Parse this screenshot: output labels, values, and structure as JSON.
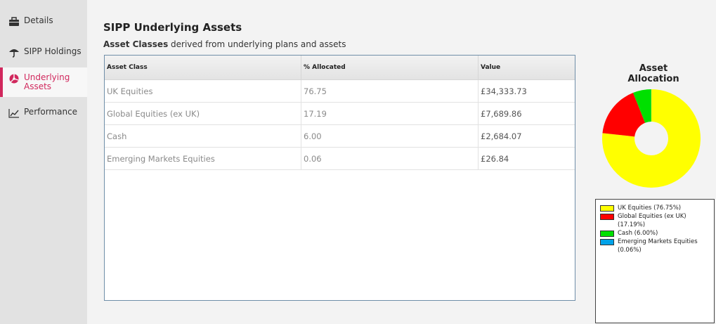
{
  "sidebar": {
    "items": [
      {
        "label": "Details",
        "icon": "briefcase-icon"
      },
      {
        "label": "SIPP Holdings",
        "icon": "umbrella-icon"
      },
      {
        "label": "Underlying Assets",
        "icon": "pie-chart-icon"
      },
      {
        "label": "Performance",
        "icon": "line-chart-icon"
      }
    ],
    "active_color": "#d1285d"
  },
  "main": {
    "title": "SIPP Underlying Assets",
    "subtitle_bold": "Asset Classes",
    "subtitle_rest": " derived from underlying plans and assets",
    "table": {
      "headers": [
        "Asset Class",
        "% Allocated",
        "Value"
      ],
      "rows": [
        [
          "UK Equities",
          "76.75",
          "£34,333.73"
        ],
        [
          "Global Equities (ex UK)",
          "17.19",
          "£7,689.86"
        ],
        [
          "Cash",
          "6.00",
          "£2,684.07"
        ],
        [
          "Emerging Markets Equities",
          "0.06",
          "£26.84"
        ]
      ]
    }
  },
  "chart_data": {
    "type": "pie",
    "title": "Asset Allocation",
    "donut": true,
    "slices": [
      {
        "label": "UK Equities",
        "value": 76.75,
        "color": "#ffff00",
        "legend": "UK Equities (76.75%)"
      },
      {
        "label": "Global Equities (ex UK)",
        "value": 17.19,
        "color": "#ff0000",
        "legend": "Global Equities (ex UK) (17.19%)"
      },
      {
        "label": "Cash",
        "value": 6.0,
        "color": "#00e000",
        "legend": "Cash (6.00%)"
      },
      {
        "label": "Emerging Markets Equities",
        "value": 0.06,
        "color": "#00a2e8",
        "legend": "Emerging Markets Equities (0.06%)"
      }
    ]
  }
}
